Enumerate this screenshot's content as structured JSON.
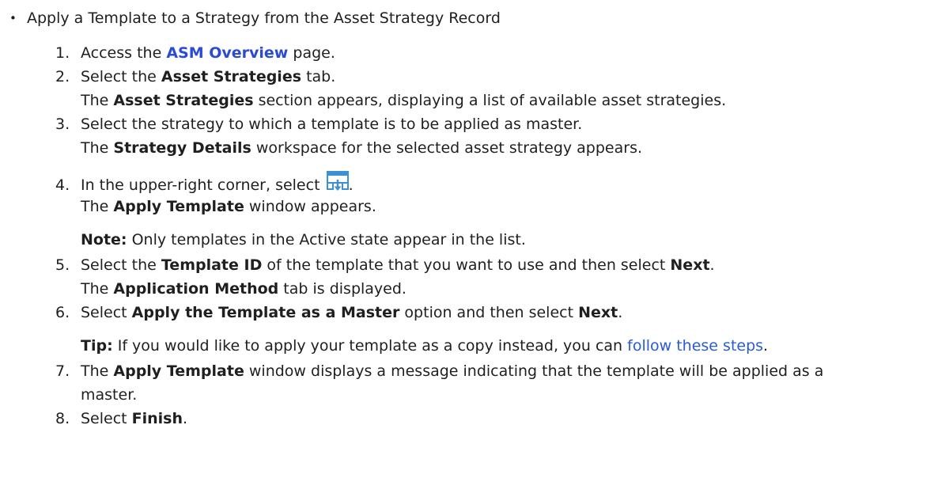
{
  "bullet": {
    "title": "Apply a Template to a Strategy from the Asset Strategy Record"
  },
  "steps": {
    "s1": {
      "num": "1.",
      "pre": "Access the ",
      "link": "ASM Overview",
      "post": " page."
    },
    "s2": {
      "num": "2.",
      "pre": "Select the ",
      "bold": "Asset Strategies",
      "post": " tab.",
      "r_bold": "Asset Strategies",
      "r_post": " section appears, displaying a list of available asset strategies.",
      "r_pre": "The "
    },
    "s3": {
      "num": "3.",
      "text": "Select the strategy to which a template is to be applied as master.",
      "r_pre": "The ",
      "r_bold": "Strategy Details",
      "r_post": " workspace for the selected asset strategy appears."
    },
    "s4": {
      "num": "4.",
      "pre": "In the upper-right corner, select ",
      "post": ".",
      "icon": "apply-template-icon",
      "r_pre": "The ",
      "r_bold": "Apply Template",
      "r_post": " window appears.",
      "note_label": "Note:",
      "note_text": " Only templates in the Active state appear in the list."
    },
    "s5": {
      "num": "5.",
      "pre": "Select the ",
      "bold1": "Template ID",
      "mid": " of the template that you want to use and then select ",
      "bold2": "Next",
      "post": ".",
      "r_pre": "The ",
      "r_bold": "Application Method",
      "r_post": " tab is displayed."
    },
    "s6": {
      "num": "6.",
      "pre": "Select ",
      "bold1": "Apply the Template as a Master",
      "mid": " option and then select ",
      "bold2": "Next",
      "post": ".",
      "tip_label": "Tip:",
      "tip_text": " If you would like to apply your template as a copy instead, you can ",
      "tip_link": "follow these steps",
      "tip_post": "."
    },
    "s7": {
      "num": "7.",
      "pre": "The ",
      "bold": "Apply Template",
      "post": " window displays a message indicating that the template will be applied as a",
      "cont": "master."
    },
    "s8": {
      "num": "8.",
      "pre": "Select ",
      "bold": "Finish",
      "post": "."
    }
  },
  "colors": {
    "link": "#2a4bd7",
    "text": "#1f1f1f",
    "icon_blue": "#3d8fd6"
  }
}
